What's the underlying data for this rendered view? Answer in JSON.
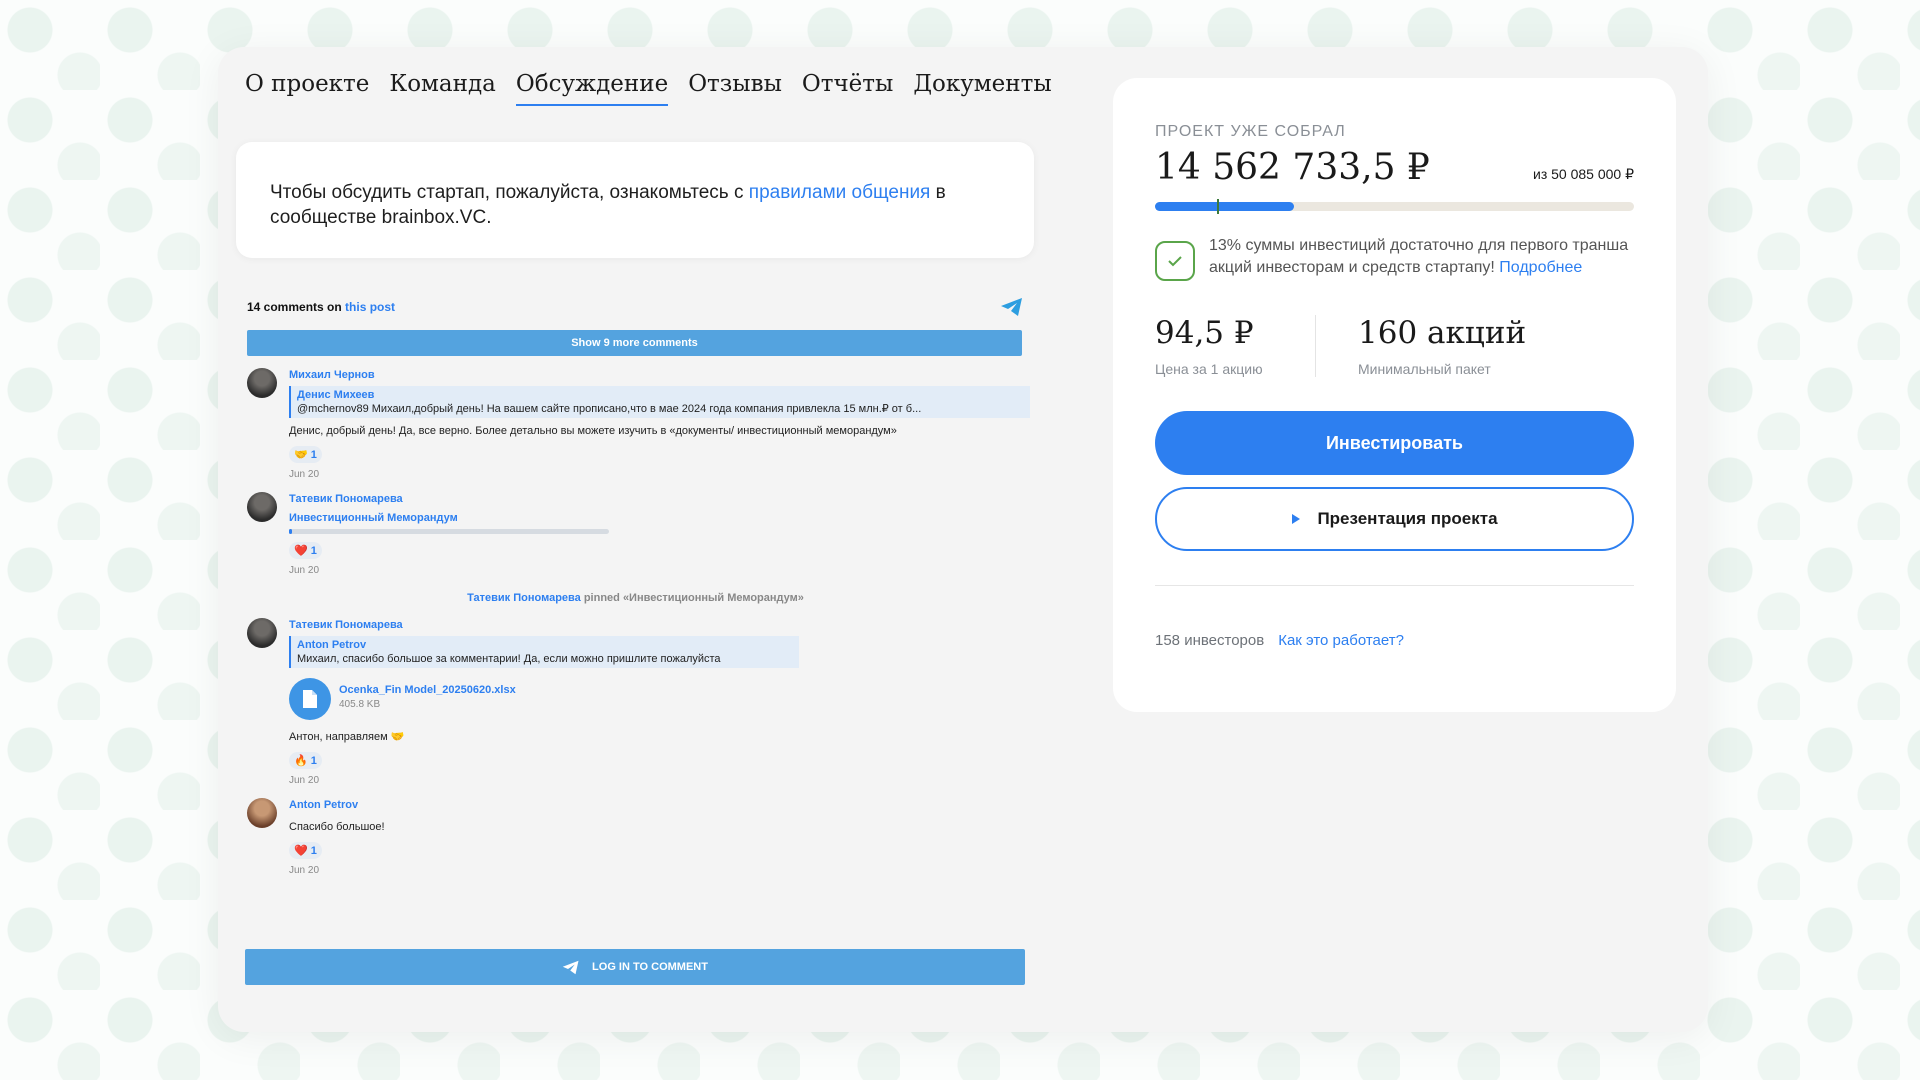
{
  "tabs": [
    "О проекте",
    "Команда",
    "Обсуждение",
    "Отзывы",
    "Отчёты",
    "Документы"
  ],
  "notice": {
    "text_before": "Чтобы обсудить стартап, пожалуйста, ознакомьтесь с ",
    "link": "правилами общения",
    "text_after": " в сообществе brainbox.VC."
  },
  "widget": {
    "count_text": "14 comments on",
    "post_link": "this post",
    "show_more": "Show 9 more comments",
    "login": "LOG IN TO COMMENT",
    "comments": [
      {
        "author": "Михаил Чернов",
        "reply_author": "Денис Михеев",
        "reply_text": "@mchernov89 Михаил,добрый день! На вашем сайте прописано,что в мае 2024 года компания привлекла 15 млн.₽ от б...",
        "text": "Денис, добрый день! Да, все верно. Более детально вы можете изучить в «документы/ инвестиционный меморандум»",
        "reaction": "🤝",
        "count": "1",
        "date": "Jun 20"
      },
      {
        "author": "Татевик Пономарева",
        "link": "Инвестиционный Меморандум",
        "reaction": "❤️",
        "count": "1",
        "date": "Jun 20"
      },
      {
        "pinned_author": "Татевик Пономарева",
        "pinned_text": " pinned «Инвестиционный Меморандум»"
      },
      {
        "author": "Татевик Пономарева",
        "reply_author": "Anton Petrov",
        "reply_text": "Михаил, спасибо большое за комментарии! Да, если можно пришлите пожалуйста",
        "file_name": "Ocenka_Fin Model_20250620.xlsx",
        "file_size": "405.8 KB",
        "text": "Антон, направляем 🤝",
        "reaction": "🔥",
        "count": "1",
        "date": "Jun 20"
      },
      {
        "author": "Anton Petrov",
        "text": "Спасибо большое!",
        "reaction": "❤️",
        "count": "1",
        "date": "Jun 20"
      }
    ]
  },
  "panel": {
    "label": "ПРОЕКТ УЖЕ СОБРАЛ",
    "amount": "14 562 733,5 ₽",
    "goal": "из 50 085 000 ₽",
    "progress_fraction": 0.29,
    "threshold_fraction": 0.13,
    "info_text": "13% суммы инвестиций достаточно для первого транша акций инвесторам и средств стартапу! ",
    "info_link": "Подробнее",
    "price_value": "94,5 ₽",
    "price_label": "Цена за 1 акцию",
    "min_value": "160 акций",
    "min_label": "Минимальный пакет",
    "invest_btn": "Инвестировать",
    "present_btn": "Презентация проекта",
    "investors": "158 инвесторов",
    "how_link": "Как это работает?"
  },
  "colors": {
    "accent": "#2d7ff0",
    "widget_blue": "#54a3df",
    "success": "#5aa54a"
  }
}
